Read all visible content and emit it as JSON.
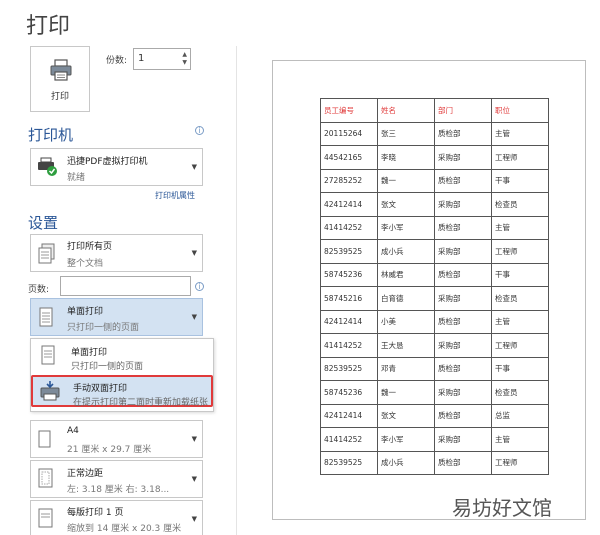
{
  "window": {
    "title": "打印"
  },
  "print_button": {
    "label": "打印"
  },
  "copies": {
    "label": "份数:",
    "value": "1"
  },
  "printer_section": {
    "heading": "打印机",
    "printer_name": "迅捷PDF虚拟打印机",
    "printer_status": "就绪",
    "properties_link": "打印机属性"
  },
  "settings_section": {
    "heading": "设置",
    "print_range": {
      "main": "打印所有页",
      "sub": "整个文档"
    },
    "pages_label": "页数:",
    "pages_value": "",
    "duplex": {
      "main": "单面打印",
      "sub": "只打印一侧的页面"
    },
    "duplex_options": [
      {
        "main": "单面打印",
        "sub": "只打印一侧的页面"
      },
      {
        "main": "手动双面打印",
        "sub": "在提示打印第二面时重新加载纸张"
      }
    ],
    "paper_size": {
      "main": "A4",
      "sub": "21 厘米 x 29.7 厘米"
    },
    "margins": {
      "main": "正常边距",
      "sub": "左: 3.18 厘米    右: 3.18..."
    },
    "pages_per_sheet": {
      "main": "每版打印 1 页",
      "sub": "缩放到 14 厘米 x 20.3 厘米"
    }
  },
  "preview_table": {
    "headers": [
      "员工编号",
      "姓名",
      "部门",
      "职位"
    ],
    "rows": [
      [
        "20115264",
        "张三",
        "质检部",
        "主管"
      ],
      [
        "44542165",
        "李晓",
        "采购部",
        "工程师"
      ],
      [
        "27285252",
        "魏一",
        "质检部",
        "干事"
      ],
      [
        "42412414",
        "张文",
        "采购部",
        "检查员"
      ],
      [
        "41414252",
        "李小军",
        "质检部",
        "主管"
      ],
      [
        "82539525",
        "成小兵",
        "采购部",
        "工程师"
      ],
      [
        "58745236",
        "林威君",
        "质检部",
        "干事"
      ],
      [
        "58745216",
        "白育德",
        "采购部",
        "检查员"
      ],
      [
        "42412414",
        "小美",
        "质检部",
        "主管"
      ],
      [
        "41414252",
        "王大恳",
        "采购部",
        "工程师"
      ],
      [
        "82539525",
        "邓青",
        "质检部",
        "干事"
      ],
      [
        "58745236",
        "魏一",
        "采购部",
        "检查员"
      ],
      [
        "42412414",
        "张文",
        "质检部",
        "总监"
      ],
      [
        "41414252",
        "李小军",
        "采购部",
        "主管"
      ],
      [
        "82539525",
        "成小兵",
        "质检部",
        "工程师"
      ]
    ]
  },
  "watermark": "易坊好文馆"
}
